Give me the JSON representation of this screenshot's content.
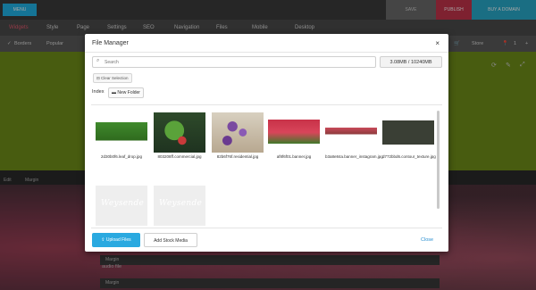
{
  "topbar": {
    "menu_label": "MENU",
    "save_label": "SAVE",
    "publish_label": "PUBLISH",
    "buy_label": "BUY A DOMAIN"
  },
  "nav": {
    "items": [
      "Widgets",
      "Style",
      "Page",
      "Settings",
      "SEO",
      "Navigation",
      "Files",
      "Mobile",
      "Desktop"
    ],
    "active": "Widgets"
  },
  "subbar": {
    "items": [
      "Borders",
      "Popular"
    ],
    "store": "Store"
  },
  "background": {
    "label_left": "Edit",
    "label_margin": "Margin",
    "rows": [
      "Margin",
      "Margin"
    ],
    "audio": "audio file"
  },
  "modal": {
    "title": "File Manager",
    "search_placeholder": "Search",
    "storage": "3.08MB / 10240MB",
    "clear_selection": "Clear Selection",
    "breadcrumb": "Index",
    "new_folder": "New Folder",
    "files": [
      {
        "caption": "2d30b0f6.leaf_drop.jpg"
      },
      {
        "caption": "803208ff.commercial.jpg"
      },
      {
        "caption": "82b6f76f.residential.jpg"
      },
      {
        "caption": "af8f6f01.banner.jpg"
      },
      {
        "caption": "b3a8e84a.banner_instagram.jpg"
      },
      {
        "caption": "d772bbd6.contour_texture.jpg"
      },
      {
        "caption": "",
        "watermark": "Weysende"
      },
      {
        "caption": "",
        "watermark": "Weysende"
      }
    ],
    "upload_label": "Upload Files",
    "stock_label": "Add Stock Media",
    "close_label": "Close"
  }
}
